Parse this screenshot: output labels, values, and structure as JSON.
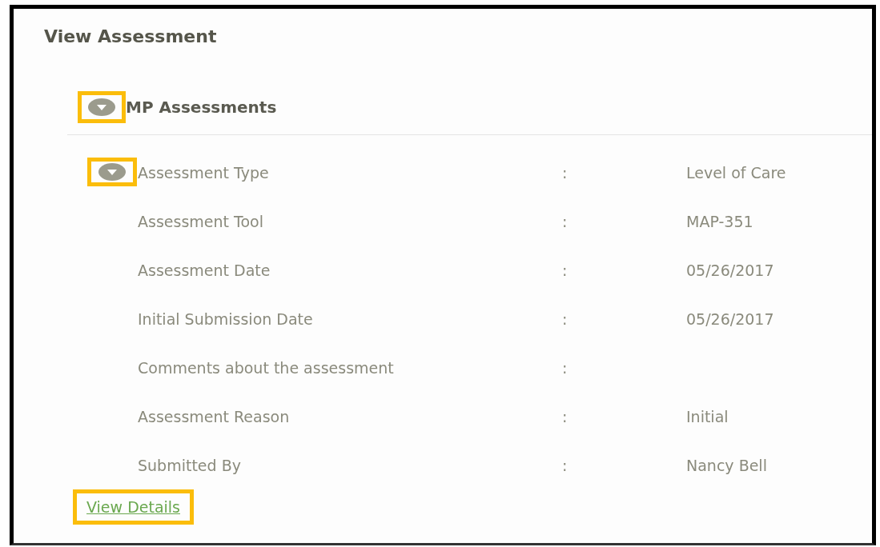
{
  "title": "View Assessment",
  "section": {
    "title": "MP Assessments",
    "expanded": true,
    "highlighted": true,
    "rows": [
      {
        "label": "Assessment Type",
        "separator": ":",
        "value": "Level of Care",
        "toggle": {
          "expanded": true,
          "highlighted": true
        }
      },
      {
        "label": "Assessment Tool",
        "separator": ":",
        "value": "MAP-351"
      },
      {
        "label": "Assessment Date",
        "separator": ":",
        "value": "05/26/2017"
      },
      {
        "label": "Initial Submission Date",
        "separator": ":",
        "value": "05/26/2017"
      },
      {
        "label": "Comments about the assessment",
        "separator": ":"
      },
      {
        "label": "Assessment Reason",
        "separator": ":",
        "value": "Initial"
      },
      {
        "label": "Submitted By",
        "separator": ":",
        "value": "Nancy Bell"
      }
    ],
    "link": {
      "label": "View Details",
      "highlighted": true
    }
  }
}
